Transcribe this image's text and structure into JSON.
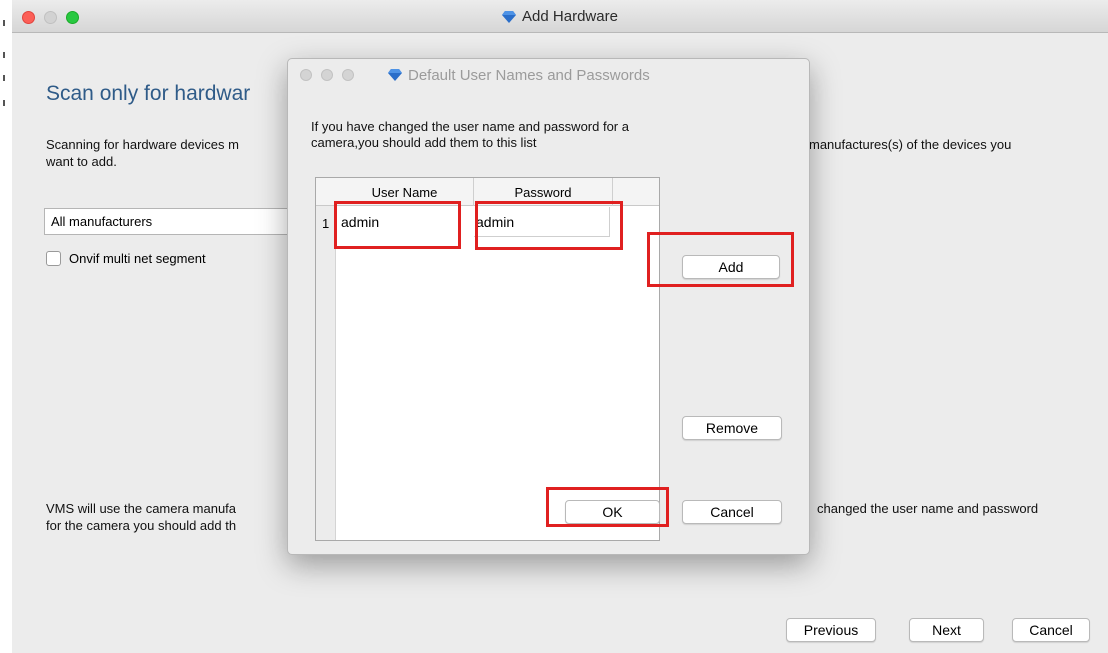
{
  "window": {
    "title": "Add Hardware"
  },
  "main": {
    "heading": "Scan only for hardwar",
    "scan_desc_left_line1": "Scanning for hardware devices m",
    "scan_desc_left_line2": "want to add.",
    "scan_desc_right": "manufactures(s) of the devices you",
    "manufacturer_select_value": "All manufacturers",
    "onvif_checkbox_label": "Onvif multi net segment",
    "vms_desc_left_line1": "VMS will use the camera manufa",
    "vms_desc_left_line2": "for the camera you should add th",
    "vms_desc_right": "changed the user name and password"
  },
  "footer": {
    "previous_label": "Previous",
    "next_label": "Next",
    "cancel_label": "Cancel"
  },
  "dialog": {
    "title": "Default User Names and Passwords",
    "desc_line1": "If you have changed the user name and password for a",
    "desc_line2": "camera,you should add them to this list",
    "table": {
      "headers": [
        "User Name",
        "Password"
      ],
      "rows": [
        {
          "index": "1",
          "username": "admin",
          "password": "admin"
        }
      ]
    },
    "add_label": "Add",
    "remove_label": "Remove",
    "ok_label": "OK",
    "cancel_label": "Cancel"
  },
  "colors": {
    "heading": "#2f5b88",
    "highlight": "#e02020",
    "close": "#fc5f57",
    "minimize": "#fdbc2e",
    "zoom": "#28c840",
    "diamond": "#2a6ec9"
  },
  "icons": {
    "app_icon": "blue-diamond-icon"
  }
}
